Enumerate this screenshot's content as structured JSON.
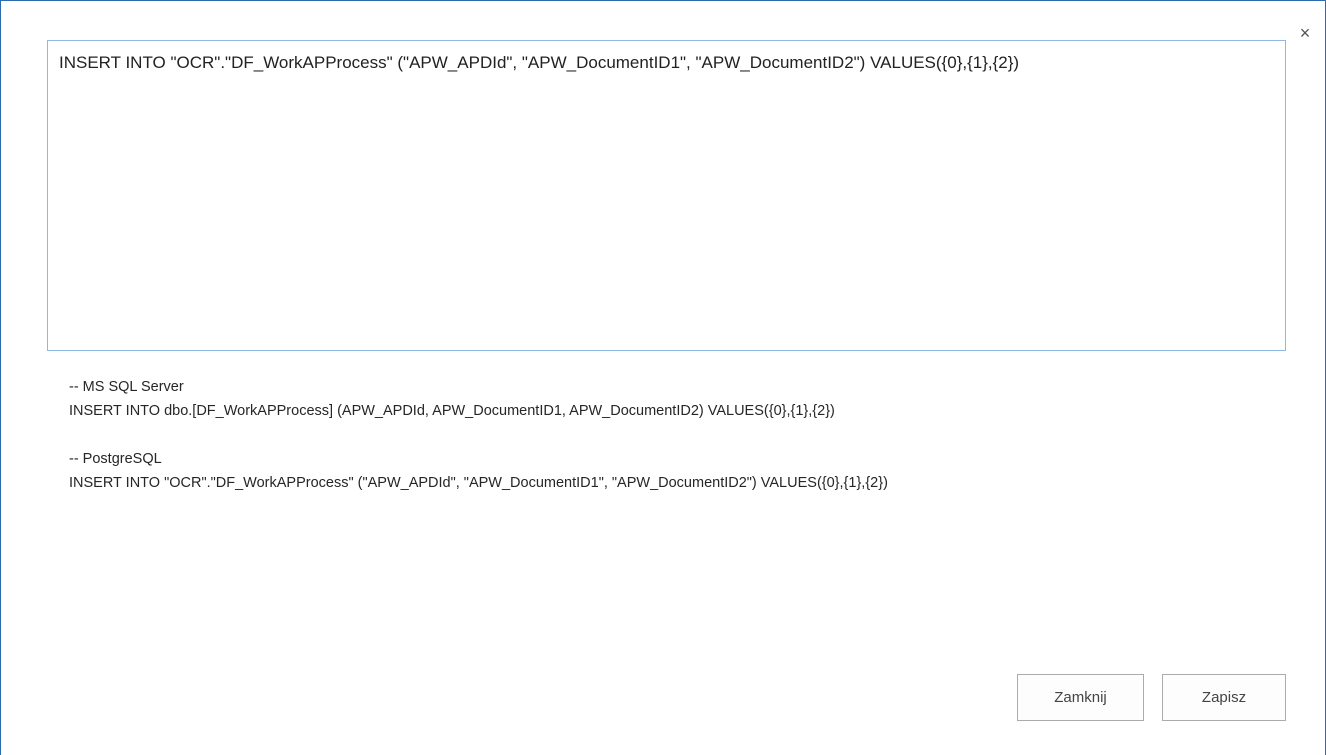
{
  "dialog": {
    "close_glyph": "×",
    "editor_value": "INSERT INTO \"OCR\".\"DF_WorkAPProcess\" (\"APW_APDId\", \"APW_DocumentID1\", \"APW_DocumentID2\") VALUES({0},{1},{2})",
    "hints": [
      {
        "comment": "-- MS SQL Server",
        "query": "INSERT INTO dbo.[DF_WorkAPProcess] (APW_APDId, APW_DocumentID1, APW_DocumentID2) VALUES({0},{1},{2})"
      },
      {
        "comment": "-- PostgreSQL",
        "query": "INSERT INTO \"OCR\".\"DF_WorkAPProcess\" (\"APW_APDId\", \"APW_DocumentID1\", \"APW_DocumentID2\") VALUES({0},{1},{2})"
      }
    ],
    "buttons": {
      "close_label": "Zamknij",
      "save_label": "Zapisz"
    }
  }
}
